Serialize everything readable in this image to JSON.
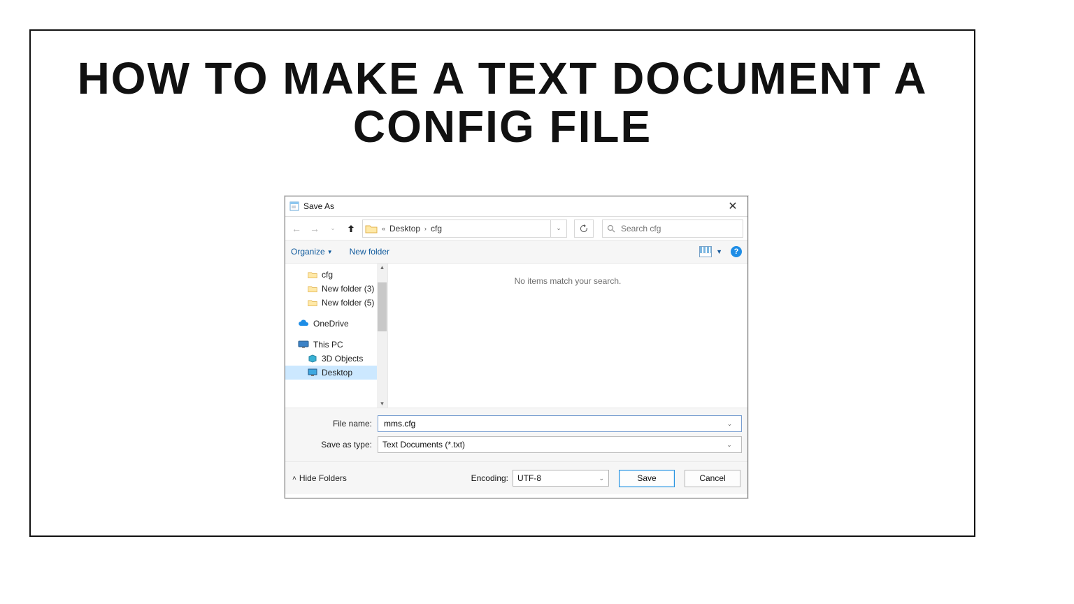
{
  "heading": "HOW TO MAKE A TEXT DOCUMENT A CONFIG FILE",
  "dialog": {
    "title": "Save As",
    "address": {
      "crumb1": "Desktop",
      "crumb2": "cfg"
    },
    "search": {
      "placeholder": "Search cfg"
    },
    "toolbar": {
      "organize": "Organize",
      "newfolder": "New folder",
      "help": "?"
    },
    "tree": {
      "items": [
        {
          "label": "cfg",
          "icon": "folder",
          "indent": true
        },
        {
          "label": "New folder (3)",
          "icon": "folder",
          "indent": true
        },
        {
          "label": "New folder (5)",
          "icon": "folder",
          "indent": true
        }
      ],
      "onedrive": "OneDrive",
      "thispc": "This PC",
      "thispc_children": [
        {
          "label": "3D Objects",
          "icon": "obj3d"
        },
        {
          "label": "Desktop",
          "icon": "desktop",
          "selected": true
        }
      ]
    },
    "empty": "No items match your search.",
    "filename_label": "File name:",
    "filename_value": "mms.cfg",
    "type_label": "Save as type:",
    "type_value": "Text Documents (*.txt)",
    "hide": "Hide Folders",
    "encoding_label": "Encoding:",
    "encoding_value": "UTF-8",
    "save": "Save",
    "cancel": "Cancel"
  }
}
